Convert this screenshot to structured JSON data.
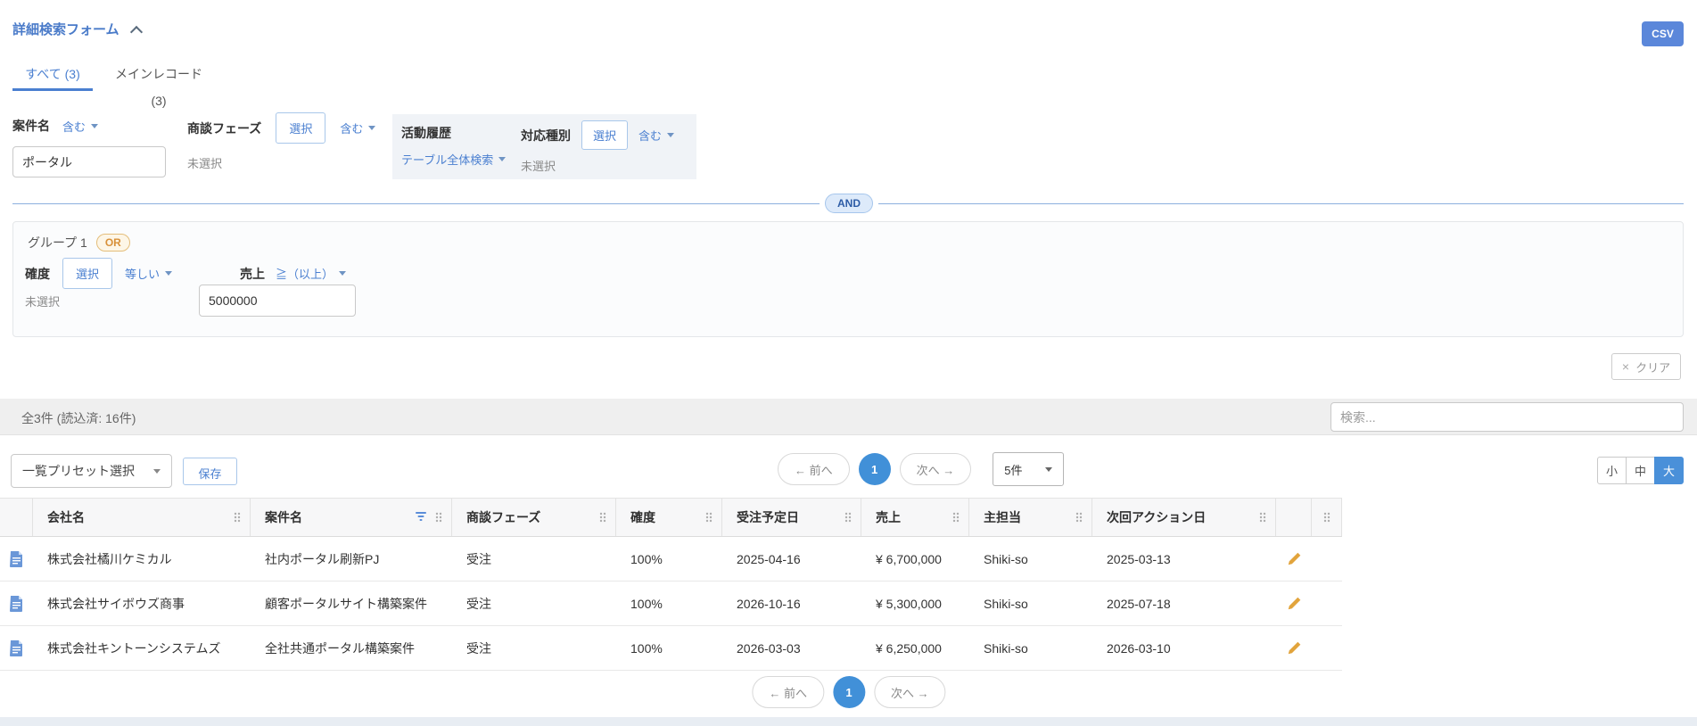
{
  "header": {
    "title": "詳細検索フォーム",
    "csv": "CSV"
  },
  "tabs": {
    "all": "すべて (3)",
    "main": "メインレコード (3)"
  },
  "filters": {
    "case_name": {
      "label": "案件名",
      "operator": "含む",
      "value": "ポータル"
    },
    "phase": {
      "label": "商談フェーズ",
      "select": "選択",
      "operator": "含む",
      "status": "未選択"
    },
    "activity": {
      "label": "活動履歴",
      "scope": "テーブル全体検索"
    },
    "response_type": {
      "label": "対応種別",
      "select": "選択",
      "operator": "含む",
      "status": "未選択"
    }
  },
  "and_label": "AND",
  "group": {
    "title": "グループ 1",
    "badge": "OR",
    "probability": {
      "label": "確度",
      "select": "選択",
      "operator": "等しい",
      "status": "未選択"
    },
    "sales": {
      "label": "売上",
      "operator": "≧（以上）",
      "value": "5000000"
    }
  },
  "clear": {
    "icon": "×",
    "label": "クリア"
  },
  "results": {
    "summary": "全3件 (読込済: 16件)",
    "search_placeholder": "検索..."
  },
  "toolbar": {
    "preset": "一覧プリセット選択",
    "save": "保存",
    "prev": "← 前へ",
    "page": "1",
    "next": "次へ →",
    "page_size": "5件",
    "size_small": "小",
    "size_medium": "中",
    "size_large": "大"
  },
  "table": {
    "columns": [
      "会社名",
      "案件名",
      "商談フェーズ",
      "確度",
      "受注予定日",
      "売上",
      "主担当",
      "次回アクション日"
    ],
    "rows": [
      {
        "company": "株式会社橘川ケミカル",
        "case": "社内ポータル刷新PJ",
        "phase": "受注",
        "probability": "100%",
        "order_date": "2025-04-16",
        "sales": "¥ 6,700,000",
        "owner": "Shiki-so",
        "next_action": "2025-03-13"
      },
      {
        "company": "株式会社サイボウズ商事",
        "case": "顧客ポータルサイト構築案件",
        "phase": "受注",
        "probability": "100%",
        "order_date": "2026-10-16",
        "sales": "¥ 5,300,000",
        "owner": "Shiki-so",
        "next_action": "2025-07-18"
      },
      {
        "company": "株式会社キントーンシステムズ",
        "case": "全社共通ポータル構築案件",
        "phase": "受注",
        "probability": "100%",
        "order_date": "2026-03-03",
        "sales": "¥ 6,250,000",
        "owner": "Shiki-so",
        "next_action": "2026-03-10"
      }
    ]
  },
  "footer": {
    "prev": "← 前へ",
    "page": "1",
    "next": "次へ →"
  },
  "colors": {
    "accent_link": "#4a7fd0",
    "accent_solid": "#4e8ad8",
    "or_badge": "#d8913a"
  }
}
